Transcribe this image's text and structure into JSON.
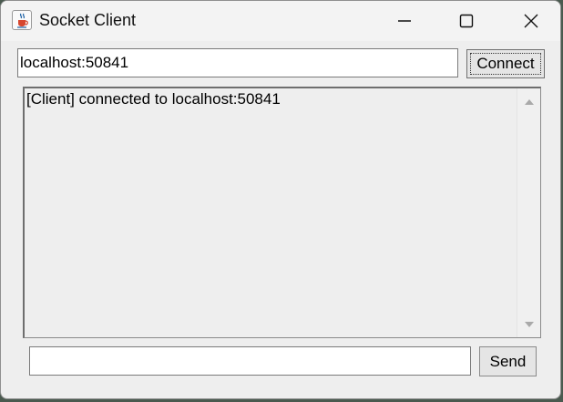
{
  "window": {
    "title": "Socket Client",
    "icon": "java-coffee-cup-icon"
  },
  "title_controls": {
    "minimize_icon": "minimize-icon",
    "maximize_icon": "maximize-icon",
    "close_icon": "close-icon"
  },
  "connection": {
    "address_value": "localhost:50841",
    "connect_label": "Connect"
  },
  "log": {
    "text": "[Client] connected to localhost:50841"
  },
  "composer": {
    "message_value": "",
    "send_label": "Send"
  },
  "colors": {
    "window_background": "#eeeeee",
    "button_background": "#e5e5e5",
    "field_background": "#ffffff"
  }
}
